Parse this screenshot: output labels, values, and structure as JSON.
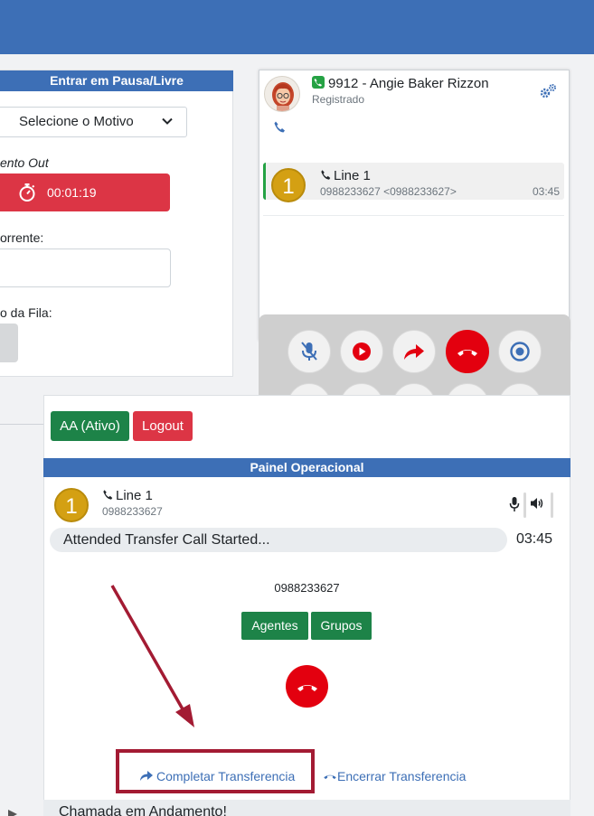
{
  "left_panel": {
    "pausa_header": "Entrar em Pausa/Livre",
    "motivo_select": "Selecione o Motivo",
    "tempo_label": "ento Out",
    "timer": "00:01:19",
    "corrente_label": "orrente:",
    "fila_label": "o da Fila:"
  },
  "phone": {
    "user": "9912 - Angie Baker Rizzon",
    "status": "Registrado",
    "line": {
      "badge": "1",
      "name": "Line 1",
      "number": "0988233627 <0988233627>",
      "time": "03:45"
    }
  },
  "controls": {
    "row1": [
      "mute-icon",
      "record-icon",
      "transfer-icon",
      "hangup-icon",
      "hold-icon"
    ],
    "row2": [
      "conference-icon",
      "keypad-icon",
      "volume-icon",
      "stats-icon",
      "list-icon"
    ]
  },
  "operational": {
    "aa_button": "AA (Ativo)",
    "logout_button": "Logout",
    "header": "Painel Operacional",
    "line": {
      "badge": "1",
      "name": "Line 1",
      "number": "0988233627"
    },
    "status": "Attended Transfer Call Started...",
    "time": "03:45",
    "dialed_number": "0988233627",
    "agentes_button": "Agentes",
    "grupos_button": "Grupos",
    "completar_link": "Completar Transferencia",
    "encerrar_link": "Encerrar Transferencia",
    "andamento": "Chamada em Andamento!"
  },
  "colors": {
    "header_blue": "#3d6fb6",
    "green": "#1d8348",
    "red": "#dc3545",
    "hangup_red": "#e3000f",
    "annotation": "#a31b33"
  }
}
